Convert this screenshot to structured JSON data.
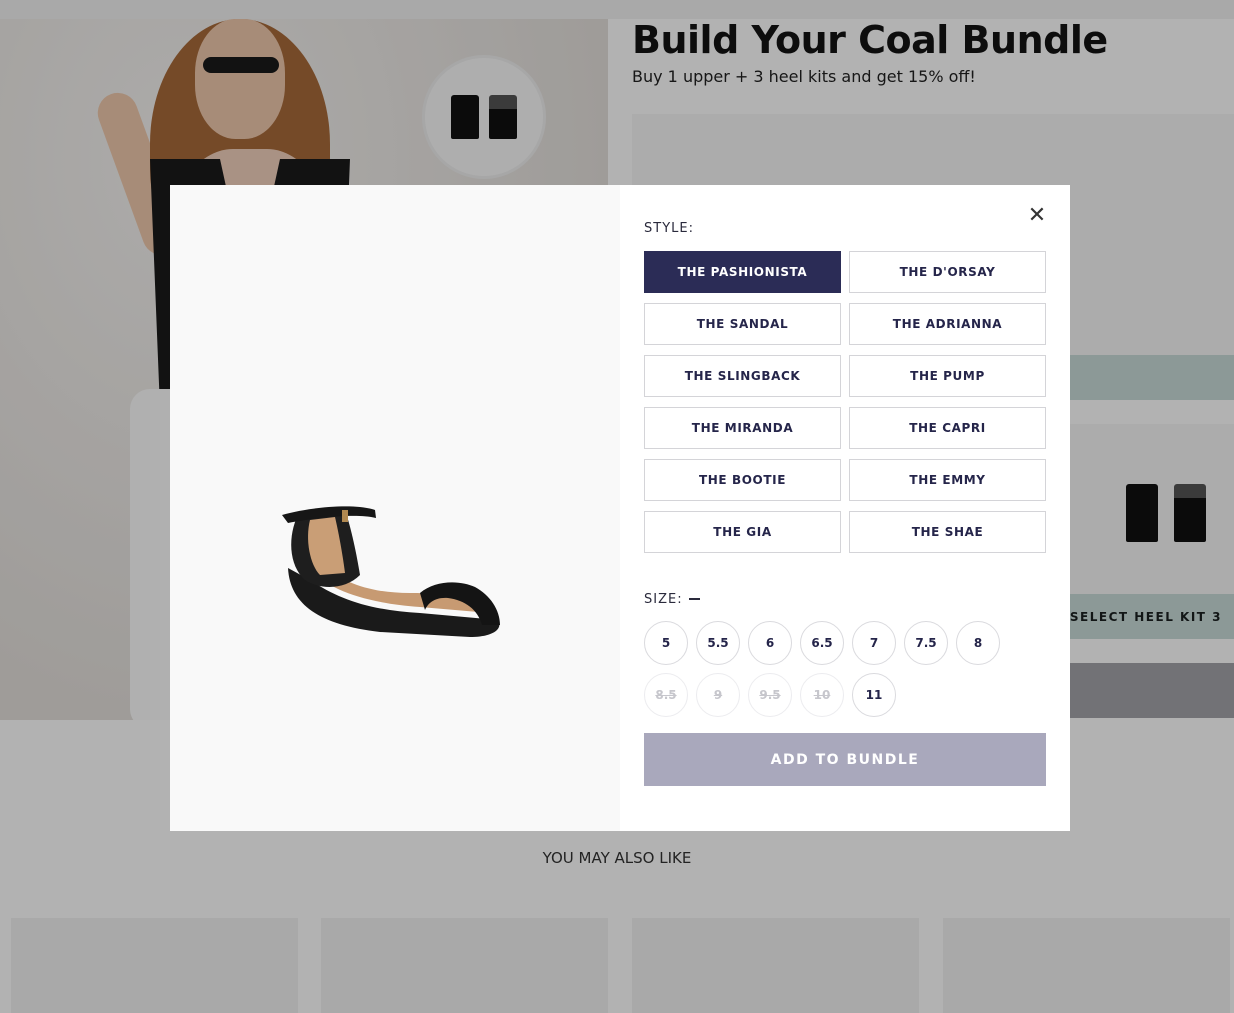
{
  "bundle": {
    "title": "Build Your Coal Bundle",
    "subtitle": "Buy 1 upper + 3 heel kits and get 15% off!",
    "heel_kit_button": "SELECT HEEL KIT 3"
  },
  "recommendations": {
    "heading": "YOU MAY ALSO LIKE"
  },
  "modal": {
    "style_label": "STYLE:",
    "selected_style": "THE PASHIONISTA",
    "styles": [
      "THE PASHIONISTA",
      "THE D'ORSAY",
      "THE SANDAL",
      "THE ADRIANNA",
      "THE SLINGBACK",
      "THE PUMP",
      "THE MIRANDA",
      "THE CAPRI",
      "THE BOOTIE",
      "THE EMMY",
      "THE GIA",
      "THE SHAE"
    ],
    "size_label": "SIZE:",
    "sizes": [
      {
        "label": "5",
        "available": true
      },
      {
        "label": "5.5",
        "available": true
      },
      {
        "label": "6",
        "available": true
      },
      {
        "label": "6.5",
        "available": true
      },
      {
        "label": "7",
        "available": true
      },
      {
        "label": "7.5",
        "available": true
      },
      {
        "label": "8",
        "available": true
      },
      {
        "label": "8.5",
        "available": false
      },
      {
        "label": "9",
        "available": false
      },
      {
        "label": "9.5",
        "available": false
      },
      {
        "label": "10",
        "available": false
      },
      {
        "label": "11",
        "available": true
      }
    ],
    "add_button": "ADD TO BUNDLE",
    "close_icon": "close-icon",
    "product_image": "black-ankle-strap-sandal"
  },
  "colors": {
    "selected_style_bg": "#2b2c56",
    "add_button_bg": "#a9a8bc",
    "slot_button_bg": "#c9dbd9"
  }
}
